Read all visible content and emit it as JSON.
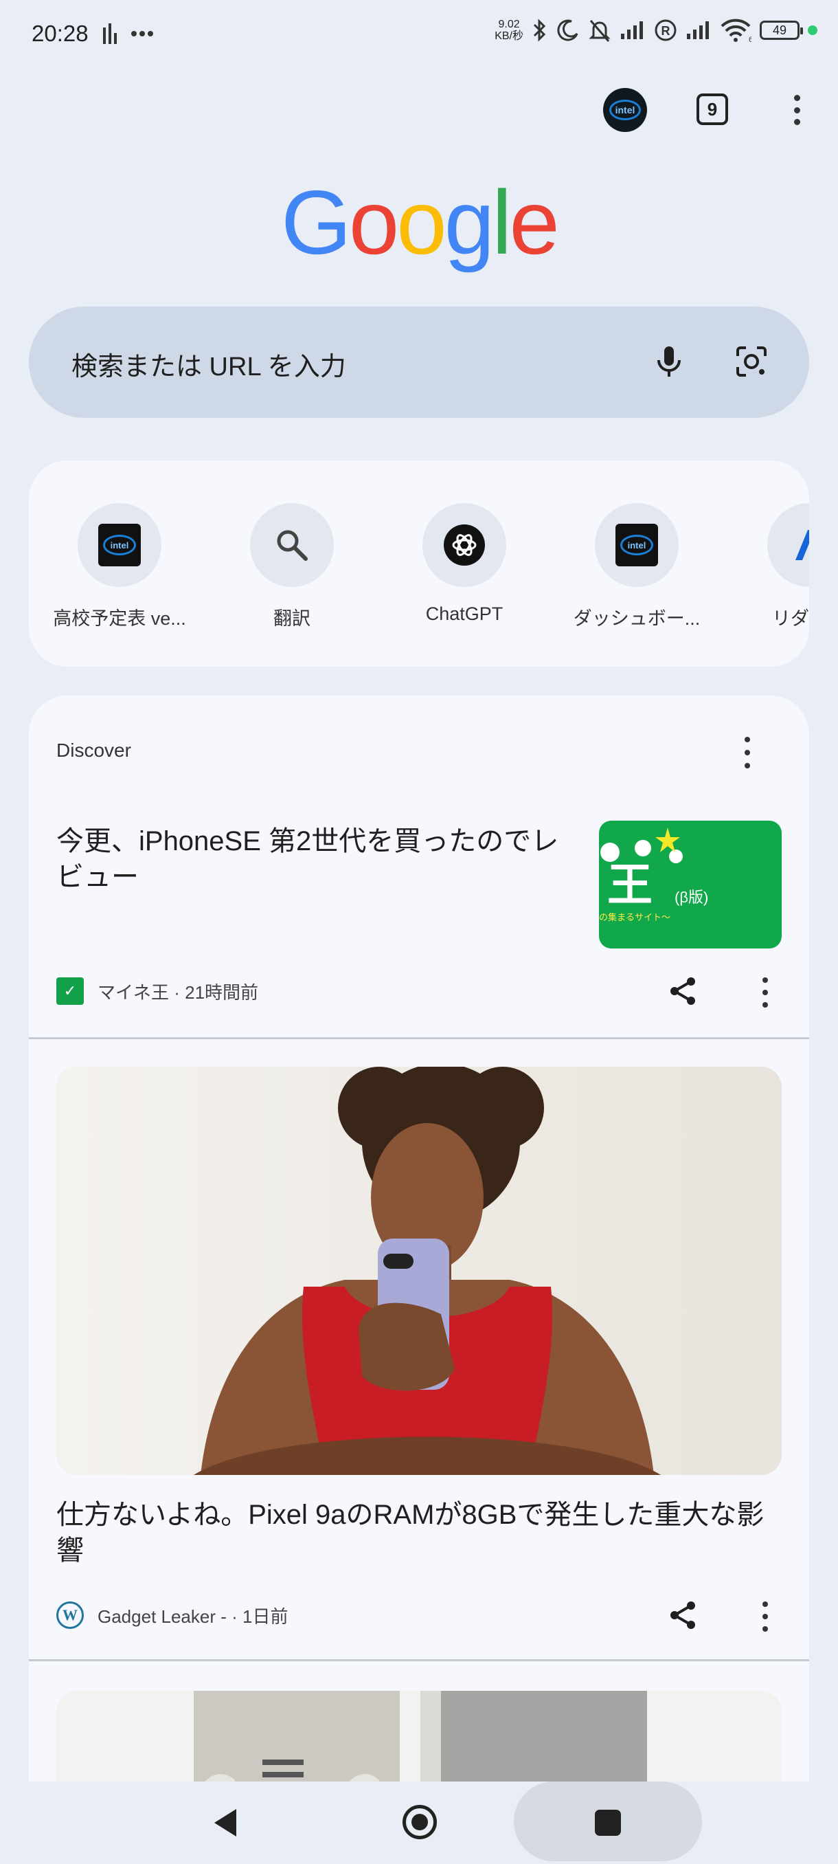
{
  "status_bar": {
    "time": "20:28",
    "net_speed_value": "9.02",
    "net_speed_unit": "KB/秒",
    "wifi_badge": "6",
    "battery": "49"
  },
  "toolbar": {
    "tab_count": "9",
    "avatar_text": "intel"
  },
  "logo": {
    "letters": [
      "G",
      "o",
      "o",
      "g",
      "l",
      "e"
    ],
    "colors": [
      "#4285F4",
      "#EA4335",
      "#FBBC05",
      "#4285F4",
      "#34A853",
      "#EA4335"
    ]
  },
  "search": {
    "placeholder": "検索または URL を入力"
  },
  "shortcuts": [
    {
      "label": "高校予定表 ve...",
      "icon": "intel-icon"
    },
    {
      "label": "翻訳",
      "icon": "search-icon"
    },
    {
      "label": "ChatGPT",
      "icon": "chatgpt-icon"
    },
    {
      "label": "ダッシュボー...",
      "icon": "intel-icon"
    },
    {
      "label": "リダイレ",
      "icon": "site-icon"
    }
  ],
  "discover": {
    "title": "Discover",
    "articles": [
      {
        "title": "今更、iPhoneSE 第2世代を買ったのでレビュー",
        "source": "マイネ王 · 21時間前",
        "thumb_text": "王",
        "thumb_beta": "(β版)",
        "thumb_sub": "の集まるサイト〜"
      },
      {
        "title": "仕方ないよね。Pixel 9aのRAMが8GBで発生した重大な影響",
        "source": "Gadget Leaker - · 1日前"
      }
    ]
  },
  "colors": {
    "background": "#e9edf5",
    "search_bar": "#cfd8e6",
    "card": "#f6f8fd"
  }
}
